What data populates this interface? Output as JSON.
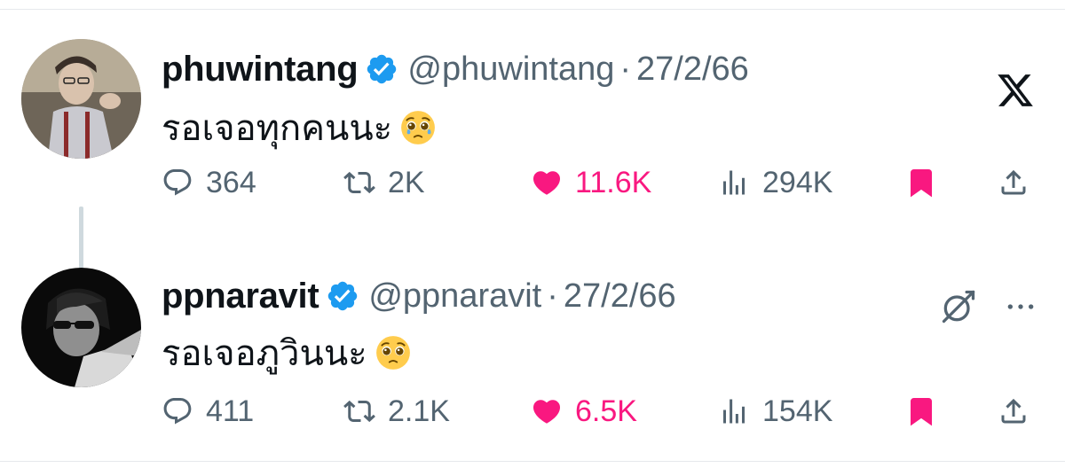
{
  "tweets": [
    {
      "display_name": "phuwintang",
      "handle": "@phuwintang",
      "separator": "·",
      "date": "27/2/66",
      "text": "รอเจอทุกคนนะ",
      "emoji": "pleading-face-with-tears-emoji",
      "replies": "364",
      "reposts": "2K",
      "likes": "11.6K",
      "views": "294K"
    },
    {
      "display_name": "ppnaravit",
      "handle": "@ppnaravit",
      "separator": "·",
      "date": "27/2/66",
      "text": "รอเจอภูวินนะ",
      "emoji": "pleading-face-emoji",
      "replies": "411",
      "reposts": "2.1K",
      "likes": "6.5K",
      "views": "154K"
    }
  ],
  "colors": {
    "verified": "#1d9bf0",
    "like": "#f91880",
    "bookmark": "#f91880",
    "muted": "#536471",
    "text": "#0f1419"
  },
  "icons": [
    "x-logo-icon",
    "grok-icon",
    "more-icon",
    "verified-badge-icon",
    "reply-icon",
    "repost-icon",
    "like-icon",
    "views-icon",
    "bookmark-icon",
    "share-icon"
  ]
}
